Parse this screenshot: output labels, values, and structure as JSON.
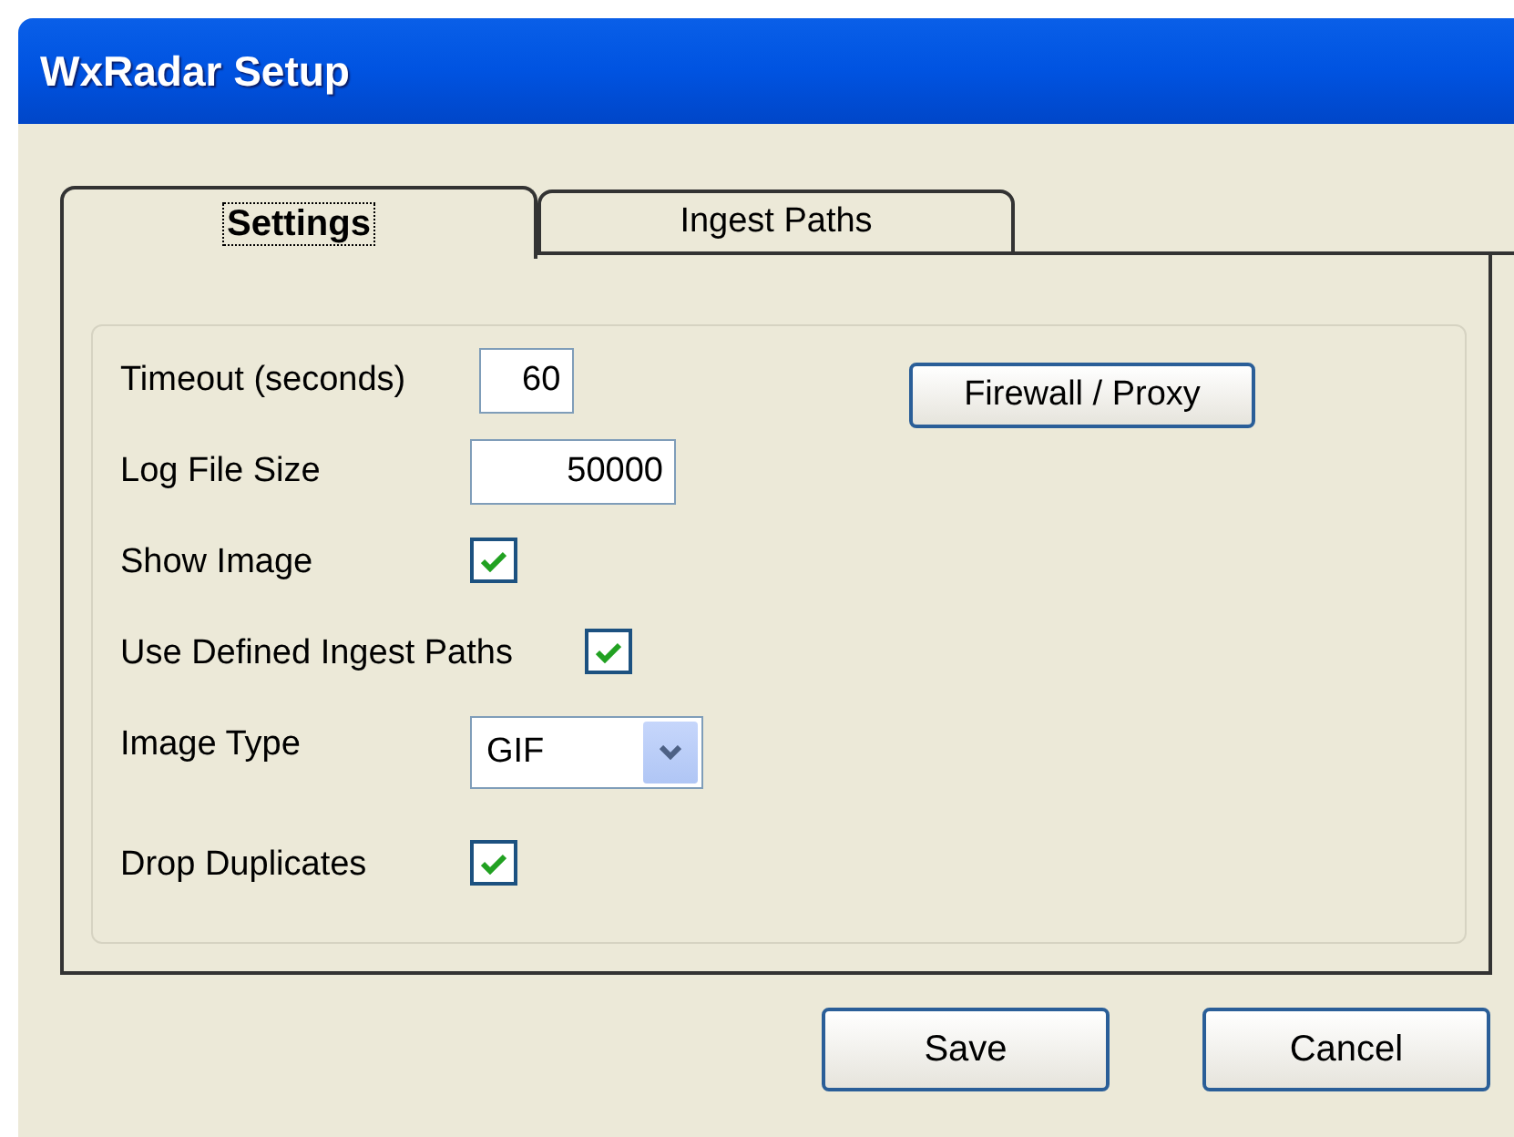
{
  "window": {
    "title": "WxRadar Setup"
  },
  "tabs": [
    {
      "label": "Settings",
      "selected": true
    },
    {
      "label": "Ingest Paths",
      "selected": false
    }
  ],
  "settings": [
    {
      "kind": "text",
      "label": "Timeout (seconds)",
      "value": "60"
    },
    {
      "kind": "text",
      "label": "Log File Size",
      "value": "50000"
    },
    {
      "kind": "checkbox",
      "label": "Show Image",
      "checked": true
    },
    {
      "kind": "checkbox",
      "label": "Use Defined Ingest Paths",
      "checked": true
    },
    {
      "kind": "select",
      "label": "Image Type",
      "value": "GIF"
    },
    {
      "kind": "checkbox",
      "label": "Drop Duplicates",
      "checked": true
    }
  ],
  "firewall_button": "Firewall / Proxy",
  "buttons": [
    "Save",
    "Cancel"
  ]
}
